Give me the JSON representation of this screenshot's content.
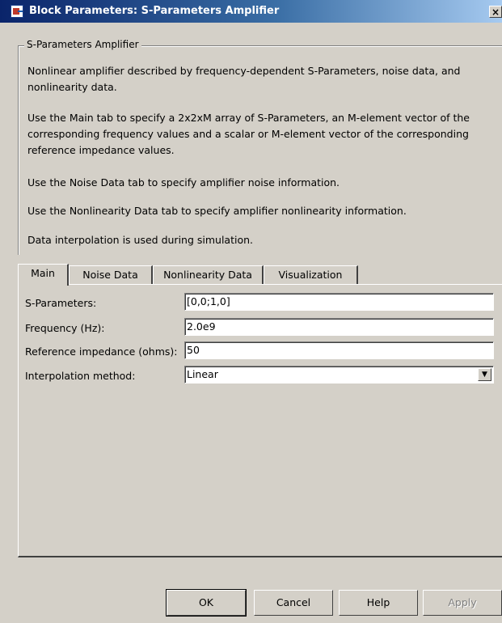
{
  "window": {
    "title": "Block Parameters: S-Parameters Amplifier",
    "close_glyph": "×"
  },
  "group": {
    "legend": "S-Parameters Amplifier",
    "paragraphs": [
      "Nonlinear amplifier described by frequency-dependent S-Parameters, noise data, and nonlinearity data.",
      "Use the Main tab to specify a 2x2xM array of S-Parameters, an M-element vector of the corresponding frequency values and a scalar or M-element vector of the corresponding reference impedance values.",
      "Use the Noise Data tab to specify amplifier noise information.",
      "Use the Nonlinearity Data tab to specify amplifier nonlinearity information.",
      "Data interpolation is used during simulation."
    ]
  },
  "tabs": [
    {
      "label": "Main",
      "active": true
    },
    {
      "label": "Noise Data",
      "active": false
    },
    {
      "label": "Nonlinearity Data",
      "active": false
    },
    {
      "label": "Visualization",
      "active": false
    }
  ],
  "main": {
    "sparams_label": "S-Parameters:",
    "sparams_value": "[0,0;1,0]",
    "freq_label": "Frequency (Hz):",
    "freq_value": "2.0e9",
    "refimp_label": "Reference impedance (ohms):",
    "refimp_value": "50",
    "interp_label": "Interpolation method:",
    "interp_value": "Linear"
  },
  "buttons": {
    "ok": "OK",
    "cancel": "Cancel",
    "help": "Help",
    "apply": "Apply"
  },
  "icons": {
    "window_icon": "simulink-block-icon",
    "dropdown": "chevron-down-icon"
  }
}
